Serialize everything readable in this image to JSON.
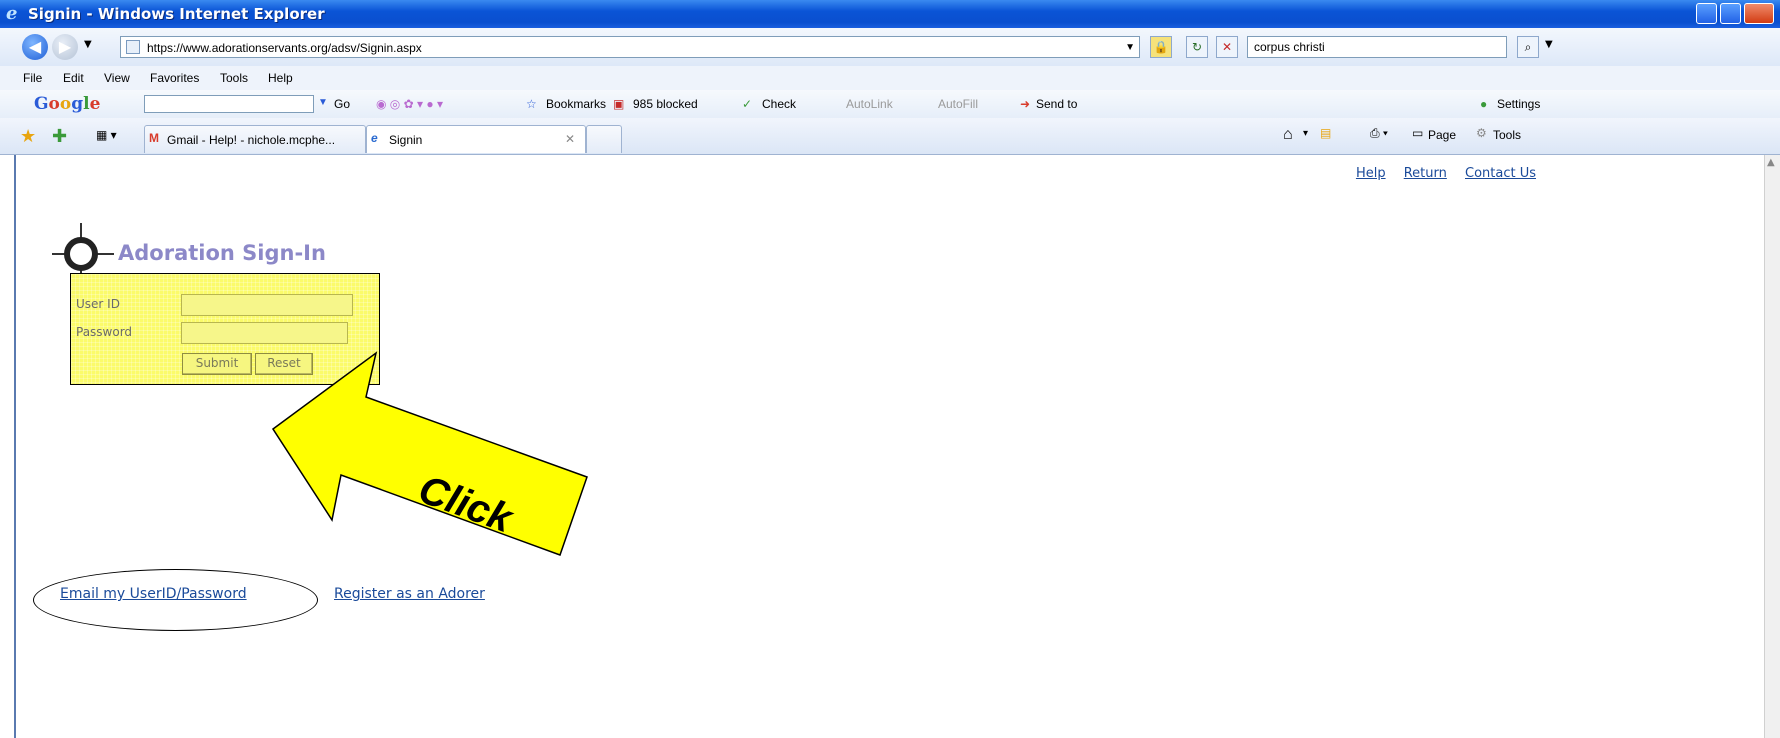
{
  "window": {
    "title": "Signin - Windows Internet Explorer"
  },
  "address_bar": {
    "url": "https://www.adorationservants.org/adsv/Signin.aspx"
  },
  "search_box": {
    "value": "corpus christi"
  },
  "menu": [
    "File",
    "Edit",
    "View",
    "Favorites",
    "Tools",
    "Help"
  ],
  "google_toolbar": {
    "logo": "Google",
    "go_label": "Go",
    "bookmarks_label": "Bookmarks",
    "blocked_label": "985 blocked",
    "check_label": "Check",
    "autolink_label": "AutoLink",
    "autofill_label": "AutoFill",
    "sendto_label": "Send to",
    "settings_label": "Settings"
  },
  "tabs": [
    {
      "label": "Gmail - Help! - nichole.mcphe..."
    },
    {
      "label": "Signin"
    }
  ],
  "command_bar": {
    "page_label": "Page",
    "tools_label": "Tools"
  },
  "page": {
    "top_links": [
      "Help",
      "Return",
      "Contact Us"
    ],
    "heading": "Adoration Sign-In",
    "form": {
      "userid_label": "User ID",
      "password_label": "Password",
      "submit_label": "Submit",
      "reset_label": "Reset",
      "userid_value": "",
      "password_value": ""
    },
    "annotation_text": "Click",
    "bottom_links": {
      "email_link": "Email my UserID/Password",
      "register_link": "Register as an Adorer"
    }
  },
  "colors": {
    "annotation_yellow": "#ffff00",
    "form_bg": "#fbfb6a",
    "heading": "#8c88c8",
    "link": "#1a4a9a"
  }
}
